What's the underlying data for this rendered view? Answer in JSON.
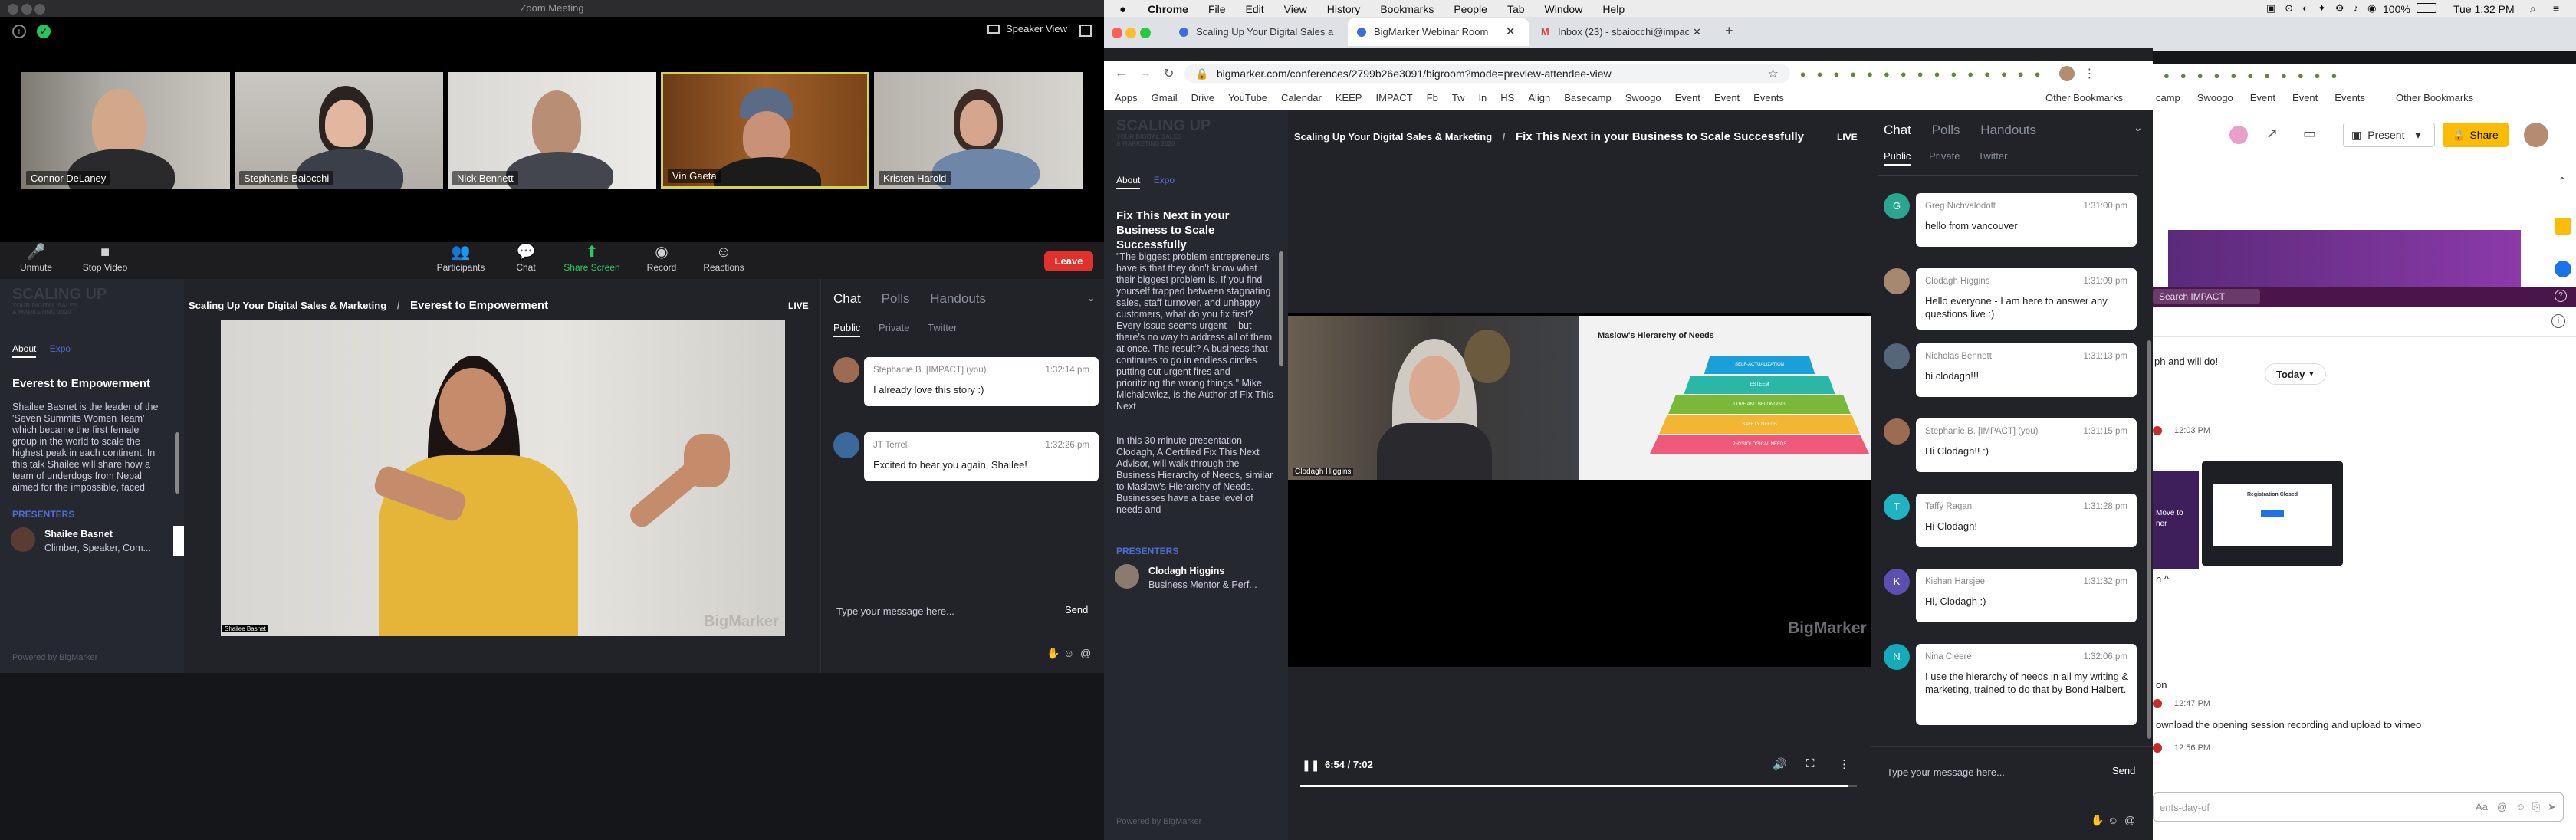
{
  "zoom": {
    "title": "Zoom Meeting",
    "view_label": "Speaker View",
    "participants": [
      "Connor DeLaney",
      "Stephanie Baiocchi",
      "Nick Bennett",
      "Vin Gaeta",
      "Kristen Harold"
    ],
    "toolbar": {
      "unmute": "Unmute",
      "stop_video": "Stop Video",
      "participants": "Participants",
      "chat": "Chat",
      "share": "Share Screen",
      "record": "Record",
      "reactions": "Reactions",
      "leave": "Leave"
    }
  },
  "bm1": {
    "logo_lines": [
      "SCALING UP",
      "YOUR DIGITAL SALES",
      "& MARKETING 2020"
    ],
    "breadcrumb_root": "Scaling Up Your Digital Sales & Marketing",
    "separator": "/",
    "session_title": "Everest to Empowerment",
    "live": "LIVE",
    "tab_about": "About",
    "tab_expo": "Expo",
    "about_title": "Everest to Empowerment",
    "about_text": "Shailee Basnet is the leader of the 'Seven Summits Women Team' which became the first female group in the world to scale the highest peak in each continent. In this talk Shailee will share how a team of underdogs from Nepal aimed for the impossible, faced various socio-economic and physical",
    "presenters_label": "PRESENTERS",
    "presenter_name": "Shailee Basnet",
    "presenter_role": "Climber, Speaker, Com...",
    "video_caption": "Shailee Basnet",
    "watermark": "BigMarker",
    "powered": "Powered by BigMarker",
    "chat_tabs": [
      "Chat",
      "Polls",
      "Handouts"
    ],
    "sub_tabs": [
      "Public",
      "Private",
      "Twitter"
    ],
    "messages": [
      {
        "name": "Stephanie B. [IMPACT] (you)",
        "time": "1:32:14 pm",
        "text": "I already love this story :)"
      },
      {
        "name": "JT Terrell",
        "time": "1:32:26 pm",
        "text": "Excited to hear you again, Shailee!"
      }
    ],
    "input_placeholder": "Type your message here...",
    "send": "Send"
  },
  "mac": {
    "menu": [
      "Chrome",
      "File",
      "Edit",
      "View",
      "History",
      "Bookmarks",
      "People",
      "Tab",
      "Window",
      "Help"
    ],
    "battery": "100%",
    "clock": "Tue 1:32 PM"
  },
  "chrome": {
    "tabs": [
      "Scaling Up Your Digital Sales a",
      "BigMarker Webinar Room",
      "Inbox (23) - sbaiocchi@impac"
    ],
    "url": "bigmarker.com/conferences/2799b26e3091/bigroom?mode=preview-attendee-view",
    "bookmarks": [
      "Apps",
      "Gmail",
      "Drive",
      "YouTube",
      "Calendar",
      "KEEP",
      "IMPACT",
      "Fb",
      "Tw",
      "In",
      "HS",
      "Align",
      "Basecamp",
      "Swoogo",
      "Event",
      "Event",
      "Events"
    ],
    "other_bookmarks": "Other Bookmarks"
  },
  "bm2": {
    "breadcrumb_root": "Scaling Up Your Digital Sales & Marketing",
    "separator": "/",
    "session_title": "Fix This Next in your Business to Scale Successfully",
    "live": "LIVE",
    "tab_about": "About",
    "tab_expo": "Expo",
    "about_title": "Fix This Next in your Business to Scale Successfully",
    "about_text": "\"The biggest problem entrepreneurs have is that they don't know what their biggest problem is. If you find yourself trapped between stagnating sales, staff turnover, and unhappy customers, what do you fix first? Every issue seems urgent -- but there's no way to address all of them at once. The result? A business that continues to go in endless circles putting out urgent fires and prioritizing the wrong things.\" Mike Michalowicz, is the Author of Fix This Next",
    "about_text2": "In this 30 minute presentation Clodagh, A Certified Fix This Next Advisor, will walk through the Business Hierarchy of Needs, similar to Maslow's Hierarchy of Needs. Businesses have a base level of needs and",
    "presenters_label": "PRESENTERS",
    "presenter_name": "Clodagh Higgins",
    "presenter_role": "Business Mentor & Perf...",
    "speaker_caption": "Clodagh Higgins",
    "slide_title": "Maslow's Hierarchy of Needs",
    "pyramid": [
      "SELF-ACTUALIZATION",
      "ESTEEM",
      "LOVE AND BELONGING",
      "SAFETY NEEDS",
      "PHYSIOLOGICAL NEEDS"
    ],
    "watermark": "BigMarker",
    "time": "6:54 / 7:02",
    "progress": 0.985,
    "powered": "Powered by BigMarker",
    "chat_tabs": [
      "Chat",
      "Polls",
      "Handouts"
    ],
    "sub_tabs": [
      "Public",
      "Private",
      "Twitter"
    ],
    "messages": [
      {
        "name": "Greg Nichvalodoff",
        "time": "1:31:00 pm",
        "text": "hello from vancouver",
        "initial": "G"
      },
      {
        "name": "Clodagh Higgins",
        "time": "1:31:09 pm",
        "text": "Hello everyone - I am here to answer any questions live :)",
        "initial": ""
      },
      {
        "name": "Nicholas Bennett",
        "time": "1:31:13 pm",
        "text": "hi clodagh!!!",
        "initial": ""
      },
      {
        "name": "Stephanie B. [IMPACT] (you)",
        "time": "1:31:15 pm",
        "text": "Hi Clodagh!! :)",
        "initial": ""
      },
      {
        "name": "Taffy Ragan",
        "time": "1:31:28 pm",
        "text": "Hi Clodagh!",
        "initial": "T"
      },
      {
        "name": "Kishan Harsjee",
        "time": "1:31:32 pm",
        "text": "Hi, Clodagh :)",
        "initial": "K"
      },
      {
        "name": "Nina Cleere",
        "time": "1:32:06 pm",
        "text": "I use the hierarchy of needs in all my writing & marketing, trained to do that by Bond Halbert.",
        "initial": "N"
      }
    ],
    "input_placeholder": "Type your message here...",
    "send": "Send"
  },
  "behind": {
    "bookmarks": [
      "camp",
      "Swoogo",
      "Event",
      "Event",
      "Events"
    ],
    "other_bookmarks": "Other Bookmarks",
    "present": "Present",
    "share": "Share",
    "search": "Search IMPACT",
    "snippet1": "ph and will do!",
    "today": "Today",
    "t1": "12:03 PM",
    "card1": "Move to",
    "card1b": "ner",
    "card2": "Registration Closed",
    "caret": "n ^",
    "on": "on",
    "t2": "12:47 PM",
    "task": "ownload the opening session recording and upload to vimeo",
    "t3": "12:56 PM",
    "input": "ents-day-of"
  }
}
